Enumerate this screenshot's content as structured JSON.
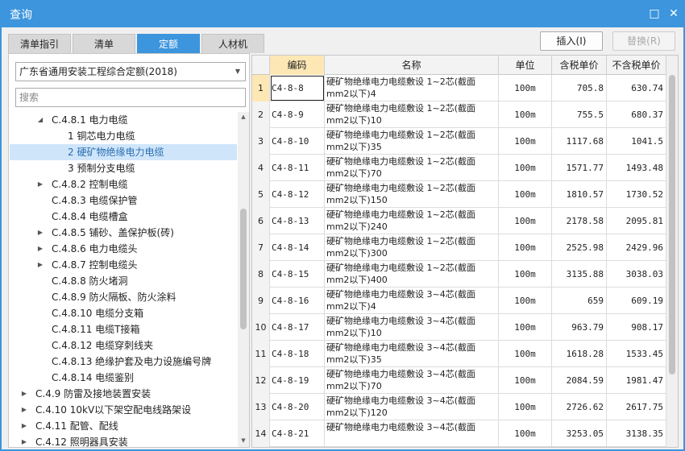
{
  "window": {
    "title": "查询",
    "restore_glyph": "□",
    "close_glyph": "✕"
  },
  "tabs": [
    {
      "label": "清单指引"
    },
    {
      "label": "清单"
    },
    {
      "label": "定额"
    },
    {
      "label": "人材机"
    }
  ],
  "toolbar": {
    "insert_label": "插入(I)",
    "replace_label": "替换(R)"
  },
  "left": {
    "library": "广东省通用安装工程综合定额(2018)",
    "search_placeholder": "搜索",
    "tree": [
      {
        "label": "C.4.8.1 电力电缆",
        "twisty": "◢",
        "level": 2
      },
      {
        "label": "1 铜芯电力电缆",
        "twisty": "",
        "level": 3
      },
      {
        "label": "2 硬矿物绝缘电力电缆",
        "twisty": "",
        "level": 3
      },
      {
        "label": "3 预制分支电缆",
        "twisty": "",
        "level": 3
      },
      {
        "label": "C.4.8.2 控制电缆",
        "twisty": "▶",
        "level": 2
      },
      {
        "label": "C.4.8.3 电缆保护管",
        "twisty": "",
        "level": 2
      },
      {
        "label": "C.4.8.4 电缆槽盒",
        "twisty": "",
        "level": 2
      },
      {
        "label": "C.4.8.5 铺砂、盖保护板(砖)",
        "twisty": "▶",
        "level": 2
      },
      {
        "label": "C.4.8.6 电力电缆头",
        "twisty": "▶",
        "level": 2
      },
      {
        "label": "C.4.8.7 控制电缆头",
        "twisty": "▶",
        "level": 2
      },
      {
        "label": "C.4.8.8 防火堵洞",
        "twisty": "",
        "level": 2
      },
      {
        "label": "C.4.8.9 防火隔板、防火涂料",
        "twisty": "",
        "level": 2
      },
      {
        "label": "C.4.8.10 电缆分支箱",
        "twisty": "",
        "level": 2
      },
      {
        "label": "C.4.8.11 电缆T接箱",
        "twisty": "",
        "level": 2
      },
      {
        "label": "C.4.8.12 电缆穿刺线夹",
        "twisty": "",
        "level": 2
      },
      {
        "label": "C.4.8.13 绝缘护套及电力设施编号牌",
        "twisty": "",
        "level": 2
      },
      {
        "label": "C.4.8.14 电缆鉴别",
        "twisty": "",
        "level": 2
      },
      {
        "label": "C.4.9 防雷及接地装置安装",
        "twisty": "▶",
        "level": 1
      },
      {
        "label": "C.4.10 10kV以下架空配电线路架设",
        "twisty": "▶",
        "level": 1
      },
      {
        "label": "C.4.11 配管、配线",
        "twisty": "▶",
        "level": 1
      },
      {
        "label": "C.4.12 照明器具安装",
        "twisty": "▶",
        "level": 1
      }
    ]
  },
  "grid": {
    "headers": {
      "code": "编码",
      "name": "名称",
      "unit": "单位",
      "taxed": "含税单价",
      "untaxed": "不含税单价"
    },
    "rows": [
      {
        "n": "1",
        "code": "C4-8-8",
        "name": "硬矿物绝缘电力电缆敷设 1~2芯(截面mm2以下)4",
        "unit": "100m",
        "taxed": "705.8",
        "untaxed": "630.74"
      },
      {
        "n": "2",
        "code": "C4-8-9",
        "name": "硬矿物绝缘电力电缆敷设 1~2芯(截面mm2以下)10",
        "unit": "100m",
        "taxed": "755.5",
        "untaxed": "680.37"
      },
      {
        "n": "3",
        "code": "C4-8-10",
        "name": "硬矿物绝缘电力电缆敷设 1~2芯(截面mm2以下)35",
        "unit": "100m",
        "taxed": "1117.68",
        "untaxed": "1041.5"
      },
      {
        "n": "4",
        "code": "C4-8-11",
        "name": "硬矿物绝缘电力电缆敷设 1~2芯(截面mm2以下)70",
        "unit": "100m",
        "taxed": "1571.77",
        "untaxed": "1493.48"
      },
      {
        "n": "5",
        "code": "C4-8-12",
        "name": "硬矿物绝缘电力电缆敷设 1~2芯(截面mm2以下)150",
        "unit": "100m",
        "taxed": "1810.57",
        "untaxed": "1730.52"
      },
      {
        "n": "6",
        "code": "C4-8-13",
        "name": "硬矿物绝缘电力电缆敷设 1~2芯(截面mm2以下)240",
        "unit": "100m",
        "taxed": "2178.58",
        "untaxed": "2095.81"
      },
      {
        "n": "7",
        "code": "C4-8-14",
        "name": "硬矿物绝缘电力电缆敷设 1~2芯(截面mm2以下)300",
        "unit": "100m",
        "taxed": "2525.98",
        "untaxed": "2429.96"
      },
      {
        "n": "8",
        "code": "C4-8-15",
        "name": "硬矿物绝缘电力电缆敷设 1~2芯(截面mm2以下)400",
        "unit": "100m",
        "taxed": "3135.88",
        "untaxed": "3038.03"
      },
      {
        "n": "9",
        "code": "C4-8-16",
        "name": "硬矿物绝缘电力电缆敷设 3~4芯(截面mm2以下)4",
        "unit": "100m",
        "taxed": "659",
        "untaxed": "609.19"
      },
      {
        "n": "10",
        "code": "C4-8-17",
        "name": "硬矿物绝缘电力电缆敷设 3~4芯(截面mm2以下)10",
        "unit": "100m",
        "taxed": "963.79",
        "untaxed": "908.17"
      },
      {
        "n": "11",
        "code": "C4-8-18",
        "name": "硬矿物绝缘电力电缆敷设 3~4芯(截面mm2以下)35",
        "unit": "100m",
        "taxed": "1618.28",
        "untaxed": "1533.45"
      },
      {
        "n": "12",
        "code": "C4-8-19",
        "name": "硬矿物绝缘电力电缆敷设 3~4芯(截面mm2以下)70",
        "unit": "100m",
        "taxed": "2084.59",
        "untaxed": "1981.47"
      },
      {
        "n": "13",
        "code": "C4-8-20",
        "name": "硬矿物绝缘电力电缆敷设 3~4芯(截面mm2以下)120",
        "unit": "100m",
        "taxed": "2726.62",
        "untaxed": "2617.75"
      },
      {
        "n": "14",
        "code": "C4-8-21",
        "name": "硬矿物绝缘电力电缆敷设 3~4芯(截面",
        "unit": "100m",
        "taxed": "3253.05",
        "untaxed": "3138.35"
      }
    ]
  }
}
